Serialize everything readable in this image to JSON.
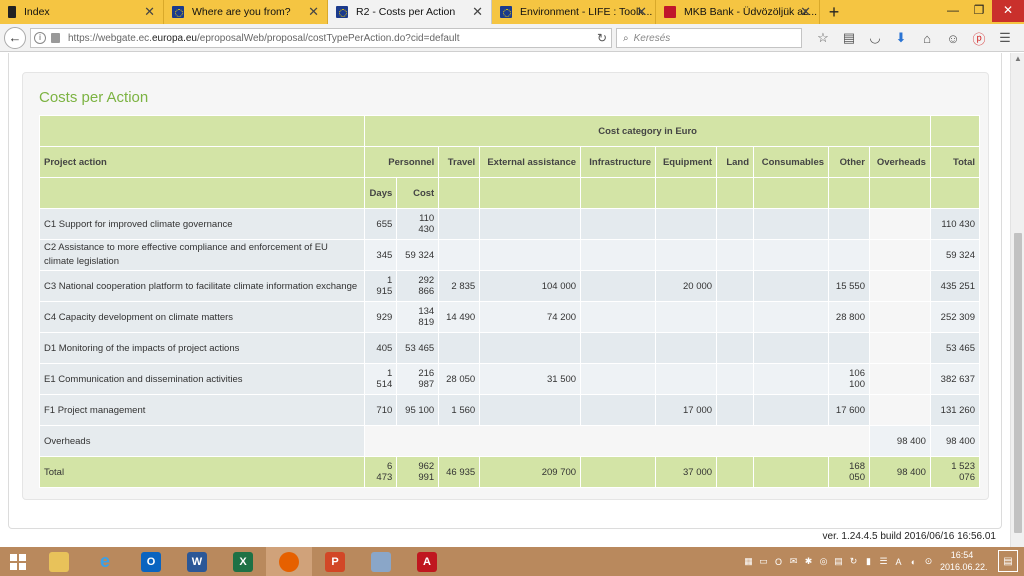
{
  "browser": {
    "tabs": [
      {
        "label": "Index",
        "icon": "document-icon"
      },
      {
        "label": "Where are you from?",
        "icon": "eu-flag-icon"
      },
      {
        "label": "R2 - Costs per Action",
        "icon": "eu-flag-icon",
        "active": true
      },
      {
        "label": "Environment - LIFE : Toolk...",
        "icon": "eu-flag-icon"
      },
      {
        "label": "MKB Bank - Üdvözöljük az...",
        "icon": "mkb-logo-icon"
      }
    ],
    "url_prefix": "https://webgate.ec.",
    "url_domain": "europa.eu",
    "url_suffix": "/eproposalWeb/proposal/costTypePerAction.do?cid=default",
    "search_placeholder": "Keresés"
  },
  "page": {
    "title": "Costs per Action",
    "table": {
      "header_project_action": "Project action",
      "header_cost_category": "Cost category in Euro",
      "columns": [
        "Personnel",
        "Travel",
        "External assistance",
        "Infrastructure",
        "Equipment",
        "Land",
        "Consumables",
        "Other",
        "Overheads",
        "Total"
      ],
      "sub_days": "Days",
      "sub_cost": "Cost",
      "rows": [
        {
          "action": "C1 Support for improved climate governance",
          "days": "655",
          "cost": "110 430",
          "travel": "",
          "external": "",
          "infrastructure": "",
          "equipment": "",
          "land": "",
          "consumables": "",
          "other": "",
          "overheads": "",
          "total": "110 430"
        },
        {
          "action": "C2 Assistance to more effective compliance and enforcement of EU climate legislation",
          "days": "345",
          "cost": "59 324",
          "travel": "",
          "external": "",
          "infrastructure": "",
          "equipment": "",
          "land": "",
          "consumables": "",
          "other": "",
          "overheads": "",
          "total": "59 324"
        },
        {
          "action": "C3 National cooperation platform to facilitate climate information exchange",
          "days": "1 915",
          "cost": "292 866",
          "travel": "2 835",
          "external": "104 000",
          "infrastructure": "",
          "equipment": "20 000",
          "land": "",
          "consumables": "",
          "other": "15 550",
          "overheads": "",
          "total": "435 251"
        },
        {
          "action": "C4 Capacity development on climate matters",
          "days": "929",
          "cost": "134 819",
          "travel": "14 490",
          "external": "74 200",
          "infrastructure": "",
          "equipment": "",
          "land": "",
          "consumables": "",
          "other": "28 800",
          "overheads": "",
          "total": "252 309"
        },
        {
          "action": "D1 Monitoring of the impacts of project actions",
          "days": "405",
          "cost": "53 465",
          "travel": "",
          "external": "",
          "infrastructure": "",
          "equipment": "",
          "land": "",
          "consumables": "",
          "other": "",
          "overheads": "",
          "total": "53 465"
        },
        {
          "action": "E1 Communication and dissemination activities",
          "days": "1 514",
          "cost": "216 987",
          "travel": "28 050",
          "external": "31 500",
          "infrastructure": "",
          "equipment": "",
          "land": "",
          "consumables": "",
          "other": "106 100",
          "overheads": "",
          "total": "382 637"
        },
        {
          "action": "F1 Project management",
          "days": "710",
          "cost": "95 100",
          "travel": "1 560",
          "external": "",
          "infrastructure": "",
          "equipment": "17 000",
          "land": "",
          "consumables": "",
          "other": "17 600",
          "overheads": "",
          "total": "131 260"
        }
      ],
      "overheads_row": {
        "label": "Overheads",
        "overheads": "98 400",
        "total": "98 400"
      },
      "total_row": {
        "label": "Total",
        "days": "6 473",
        "cost": "962 991",
        "travel": "46 935",
        "external": "209 700",
        "infrastructure": "",
        "equipment": "37 000",
        "land": "",
        "consumables": "",
        "other": "168 050",
        "overheads": "98 400",
        "total": "1 523 076"
      }
    },
    "version": "ver. 1.24.4.5 build 2016/06/16 16:56.01"
  },
  "taskbar": {
    "clock_time": "16:54",
    "clock_date": "2016.06.22."
  },
  "colors": {
    "tabbar": "#f5c542",
    "title_green": "#7cb342",
    "header_green": "#d3e4a6",
    "taskbar": "#b9895d"
  }
}
